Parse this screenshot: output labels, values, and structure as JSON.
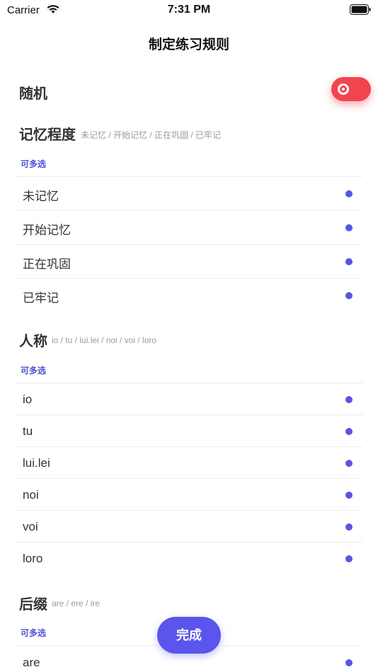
{
  "status_bar": {
    "carrier": "Carrier",
    "time": "7:31 PM"
  },
  "nav": {
    "title": "制定练习规则"
  },
  "random": {
    "label": "随机",
    "enabled": true
  },
  "memory": {
    "title": "记忆程度",
    "subtitle": "未记忆 / 开始记忆 / 正在巩固 / 已牢记",
    "hint": "可多选",
    "items": [
      "未记忆",
      "开始记忆",
      "正在巩固",
      "已牢记"
    ]
  },
  "person": {
    "title": "人称",
    "subtitle": "io / tu / lui.lei / noi / voi / loro",
    "hint": "可多选",
    "items": [
      "io",
      "tu",
      "lui.lei",
      "noi",
      "voi",
      "loro"
    ]
  },
  "suffix": {
    "title": "后缀",
    "subtitle": "are / ere / ire",
    "hint": "可多选",
    "items": [
      "are"
    ]
  },
  "footer": {
    "done_label": "完成"
  },
  "colors": {
    "accent": "#5856e0",
    "toggle_on": "#f2444e",
    "button": "#5b55ee"
  }
}
